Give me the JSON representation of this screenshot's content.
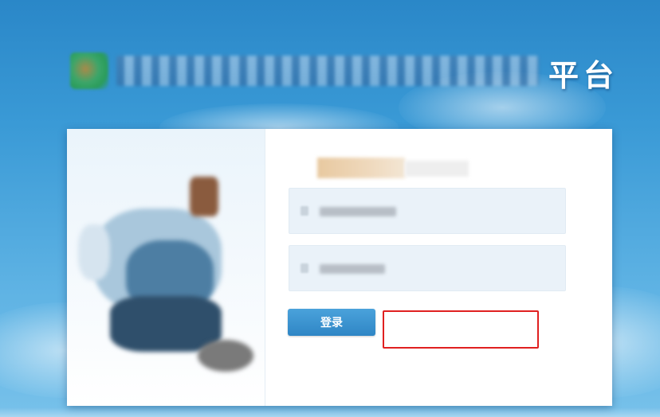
{
  "header": {
    "title_tail": "平台"
  },
  "login_form": {
    "username_field": {
      "value": "",
      "placeholder": ""
    },
    "password_field": {
      "value": "",
      "placeholder": ""
    },
    "login_button_label": "登录",
    "message_box_text": ""
  },
  "icons": {
    "logo": "logo-icon",
    "username": "user-icon",
    "password": "lock-icon"
  },
  "colors": {
    "background": "#3a9ad6",
    "button": "#3a93d0",
    "error_border": "#e02020",
    "title_text": "#ffffff"
  }
}
